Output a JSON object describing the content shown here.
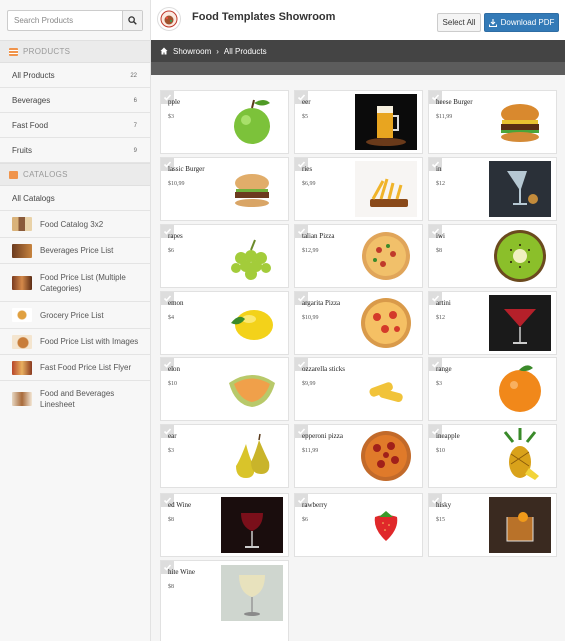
{
  "sidebar": {
    "search_placeholder": "Search Products",
    "products_header": "PRODUCTS",
    "catalogs_header": "CATALOGS",
    "products": [
      {
        "label": "All Products",
        "count": "22"
      },
      {
        "label": "Beverages",
        "count": "6"
      },
      {
        "label": "Fast Food",
        "count": "7"
      },
      {
        "label": "Fruits",
        "count": "9"
      }
    ],
    "all_catalogs_label": "All Catalogs",
    "catalogs": [
      {
        "label": "Food Catalog 3x2"
      },
      {
        "label": "Beverages Price List"
      },
      {
        "label": "Food Price List (Multiple Categories)"
      },
      {
        "label": "Grocery Price List"
      },
      {
        "label": "Food Price List with Images"
      },
      {
        "label": "Fast Food Price List Flyer"
      },
      {
        "label": "Food and Beverages Linesheet"
      }
    ]
  },
  "header": {
    "title": "Food Templates Showroom",
    "select_all": "Select All",
    "download_pdf": "Download PDF"
  },
  "breadcrumb": {
    "root": "Showroom",
    "current": "All Products"
  },
  "products": [
    {
      "name": "pple",
      "price": "$3"
    },
    {
      "name": "eer",
      "price": "$5"
    },
    {
      "name": "heese Burger",
      "price": "$11,99"
    },
    {
      "name": "lassic Burger",
      "price": "$10,99"
    },
    {
      "name": "ries",
      "price": "$6,99"
    },
    {
      "name": "in",
      "price": "$12"
    },
    {
      "name": "rapes",
      "price": "$6"
    },
    {
      "name": "talian Pizza",
      "price": "$12,99"
    },
    {
      "name": "iwi",
      "price": "$8"
    },
    {
      "name": "emon",
      "price": "$4"
    },
    {
      "name": "argarita Pizza",
      "price": "$10,99"
    },
    {
      "name": "artini",
      "price": "$12"
    },
    {
      "name": "elon",
      "price": "$10"
    },
    {
      "name": "ozzarella sticks",
      "price": "$9,99"
    },
    {
      "name": "range",
      "price": "$3"
    },
    {
      "name": "ear",
      "price": "$3"
    },
    {
      "name": "epperoni pizza",
      "price": "$11,99"
    },
    {
      "name": "ineapple",
      "price": "$10"
    },
    {
      "name": "ed Wine",
      "price": "$8"
    },
    {
      "name": "rawberry",
      "price": "$6"
    },
    {
      "name": "hisky",
      "price": "$15"
    },
    {
      "name": "hite Wine",
      "price": "$8"
    }
  ],
  "colors": {
    "accent": "#337ab7",
    "products_icon": "#f0944c",
    "catalogs_icon": "#f0944c",
    "breadcrumb_bg": "#444444"
  },
  "icons": {
    "search": "search-icon",
    "home": "home-icon",
    "download": "download-icon",
    "check": "check-icon"
  }
}
